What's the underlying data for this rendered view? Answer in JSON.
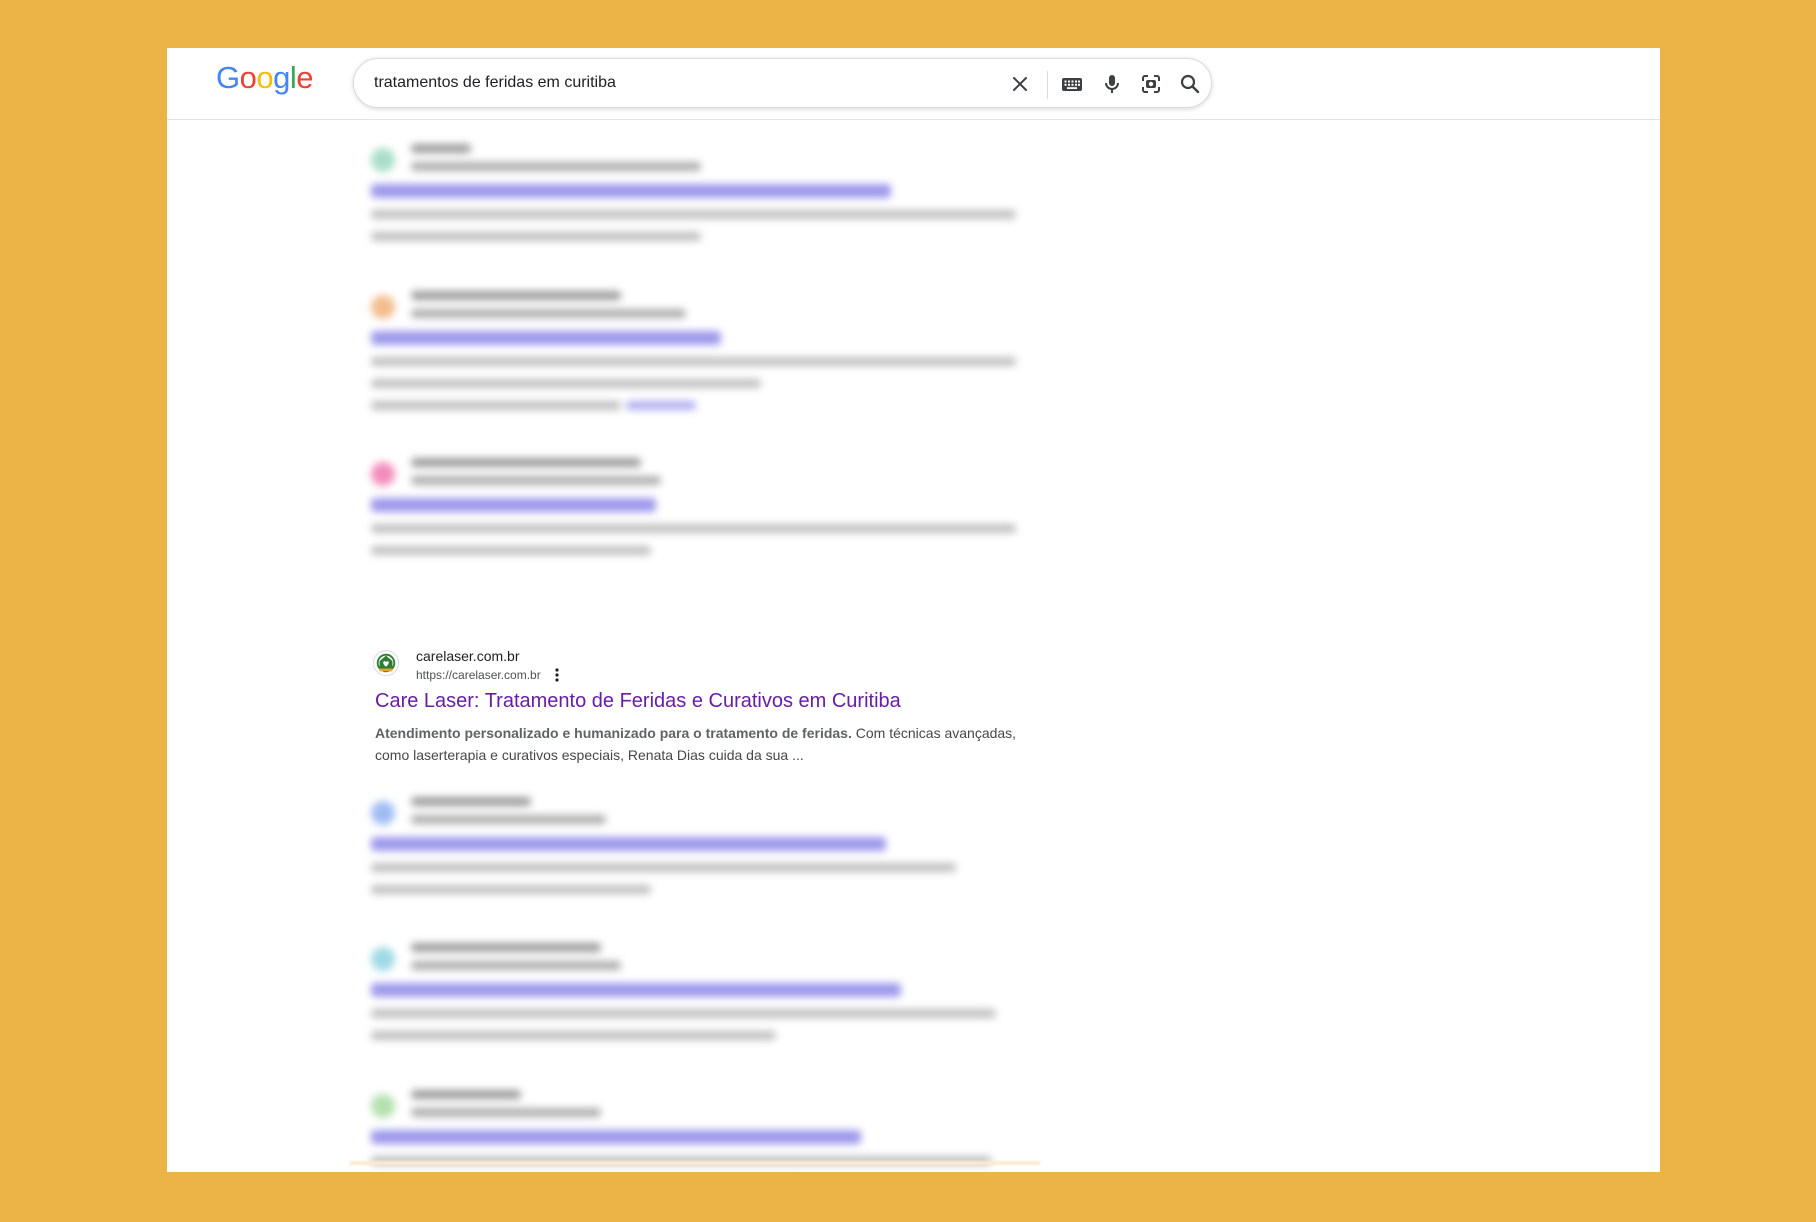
{
  "colors": {
    "background": "#ECB447",
    "link_visited": "#681da8",
    "google_blue": "#4285F4",
    "google_red": "#EA4335",
    "google_yellow": "#FBBC05",
    "google_green": "#34A853"
  },
  "header": {
    "logo_letters": [
      "G",
      "o",
      "o",
      "g",
      "l",
      "e"
    ],
    "search": {
      "query": "tratamentos de feridas em curitiba",
      "icons": [
        "clear-icon",
        "keyboard-icon",
        "microphone-icon",
        "lens-icon",
        "search-icon"
      ]
    }
  },
  "featured_result": {
    "site_name": "carelaser.com.br",
    "url": "https://carelaser.com.br",
    "title": "Care Laser: Tratamento de Feridas e Curativos em Curitiba",
    "snippet_bold": "Atendimento personalizado e humanizado para o tratamento de feridas.",
    "snippet_rest": " Com técnicas avançadas, como laserterapia e curativos especiais, Renata Dias cuida da sua ..."
  }
}
